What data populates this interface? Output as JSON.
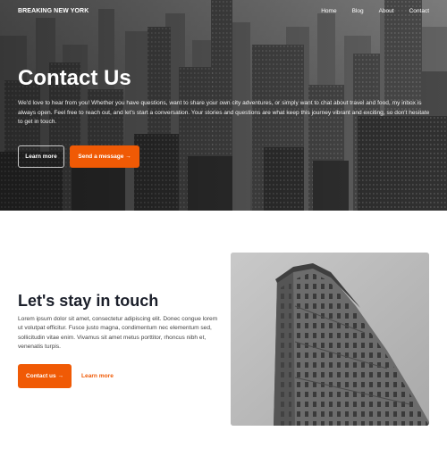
{
  "nav": {
    "brand": "BREAKING NEW YORK",
    "links": [
      "Home",
      "Blog",
      "About",
      "Contact"
    ]
  },
  "hero": {
    "title": "Contact Us",
    "text": "We'd love to hear from you! Whether you have questions, want to share your own city adventures, or simply want to chat about travel and food, my inbox is always open. Feel free to reach out, and let's start a conversation. Your stories and questions are what keep this journey vibrant and exciting, so don't hesitate to get in touch.",
    "learn_more_label": "Learn more",
    "send_message_label": "Send a message →"
  },
  "touch": {
    "title": "Let's stay in touch",
    "text": "Lorem ipsum dolor sit amet, consectetur adipiscing elit. Donec congue lorem ut volutpat efficitur. Fusce justo magna, condimentum nec elementum sed, sollicitudin vitae enim. Vivamus sit amet metus porttitor, rhoncus nibh et, venenatis turpis.",
    "contact_label": "Contact us →",
    "learn_more_label": "Learn more"
  },
  "colors": {
    "accent": "#f05a05",
    "heading": "#1b1f2a"
  },
  "images": {
    "hero": "new-york-skyline-grayscale",
    "photo": "flatiron-building-grayscale"
  }
}
